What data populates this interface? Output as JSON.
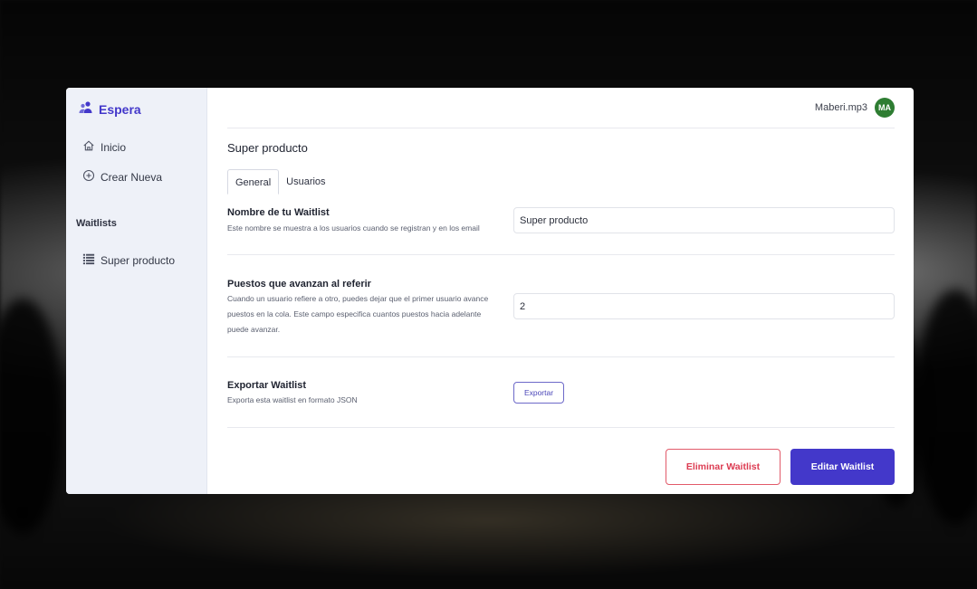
{
  "brand": {
    "name": "Espera",
    "accent": "#4338ca"
  },
  "sidebar": {
    "items": [
      {
        "label": "Inicio",
        "icon": "home-icon"
      },
      {
        "label": "Crear Nueva",
        "icon": "plus-circle-icon"
      }
    ],
    "section_label": "Waitlists",
    "waitlists": [
      {
        "label": "Super producto",
        "icon": "list-icon"
      }
    ]
  },
  "header": {
    "username": "Maberi.mp3",
    "avatar_initials": "MA",
    "avatar_color": "#2e7d32"
  },
  "page": {
    "title": "Super producto"
  },
  "tabs": [
    {
      "label": "General",
      "active": true
    },
    {
      "label": "Usuarios",
      "active": false
    }
  ],
  "fields": {
    "name": {
      "title": "Nombre de tu Waitlist",
      "description": "Este nombre se muestra a los usuarios cuando se registran y en los email",
      "value": "Super producto"
    },
    "referral": {
      "title": "Puestos que avanzan al referir",
      "description": "Cuando un usuario refiere a otro, puedes dejar que el primer usuario avance puestos en la cola. Este campo especifica cuantos puestos hacia adelante puede avanzar.",
      "value": "2"
    },
    "export": {
      "title": "Exportar Waitlist",
      "description": "Exporta esta waitlist en formato JSON",
      "button_label": "Exportar"
    }
  },
  "actions": {
    "delete_label": "Eliminar Waitlist",
    "edit_label": "Editar Waitlist",
    "danger_color": "#dc3c52"
  }
}
